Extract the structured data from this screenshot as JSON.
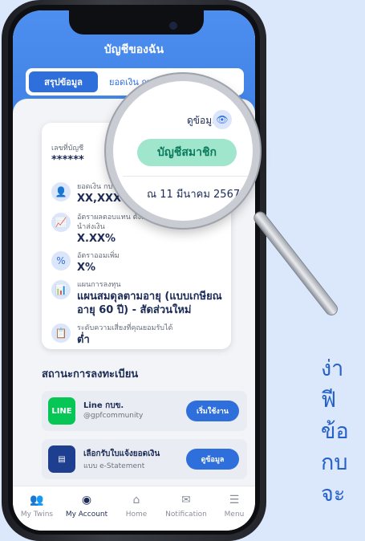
{
  "side_text": [
    "ง่า",
    "ฟี",
    "ข้อ",
    "กบ",
    "จะ"
  ],
  "app": {
    "title": "บัญชีของฉัน"
  },
  "tabs": [
    {
      "label": "สรุปข้อมูล",
      "active": true
    },
    {
      "label": "ยอดเงิน กบข.",
      "active": false
    }
  ],
  "account": {
    "number_label": "เลขที่บัญชี",
    "number_value": "******",
    "view_label": "ดูข้อมูล",
    "member_badge": "บัญชีสมาชิก",
    "as_of_date": "ณ 11 มีนาคม 2567",
    "rows": [
      {
        "label": "ยอดเงิน กบข.",
        "value": "XX,XXX"
      },
      {
        "label": "อัตราผลตอบแทน ตั้งแต่เริ่มนำส่งเงิน",
        "value": "X.XX%"
      },
      {
        "label": "อัตราออมเพิ่ม",
        "value": "X%"
      },
      {
        "label": "แผนการลงทุน",
        "value": "แผนสมดุลตามอายุ (แบบเกษียณอายุ 60 ปี) - สัดส่วนใหม่"
      },
      {
        "label": "ระดับความเสี่ยงที่คุณยอมรับได้",
        "value": "ต่ำ"
      }
    ]
  },
  "registration": {
    "title": "สถานะการลงทะเบียน",
    "items": [
      {
        "name": "Line กบข.",
        "sub": "@gpfcommunity",
        "button": "เริ่มใช้งาน",
        "logo": "LINE",
        "color": "#06c755"
      },
      {
        "name": "เลือกรับใบแจ้งยอดเงิน",
        "sub": "แบบ e-Statement",
        "button": "ดูข้อมูล",
        "logo": "",
        "color": "#1e3f8f"
      }
    ]
  },
  "nav": [
    {
      "label": "My Twins",
      "icon": "twins-icon",
      "active": false
    },
    {
      "label": "My Account",
      "icon": "user-icon",
      "active": true
    },
    {
      "label": "Home",
      "icon": "home-icon",
      "active": false
    },
    {
      "label": "Notification",
      "icon": "mail-icon",
      "active": false
    },
    {
      "label": "Menu",
      "icon": "menu-icon",
      "active": false
    }
  ],
  "colors": {
    "primary": "#2f6fdb",
    "navy": "#1b2b55",
    "mint": "#9fe6cd",
    "background": "#dbe8fb"
  }
}
